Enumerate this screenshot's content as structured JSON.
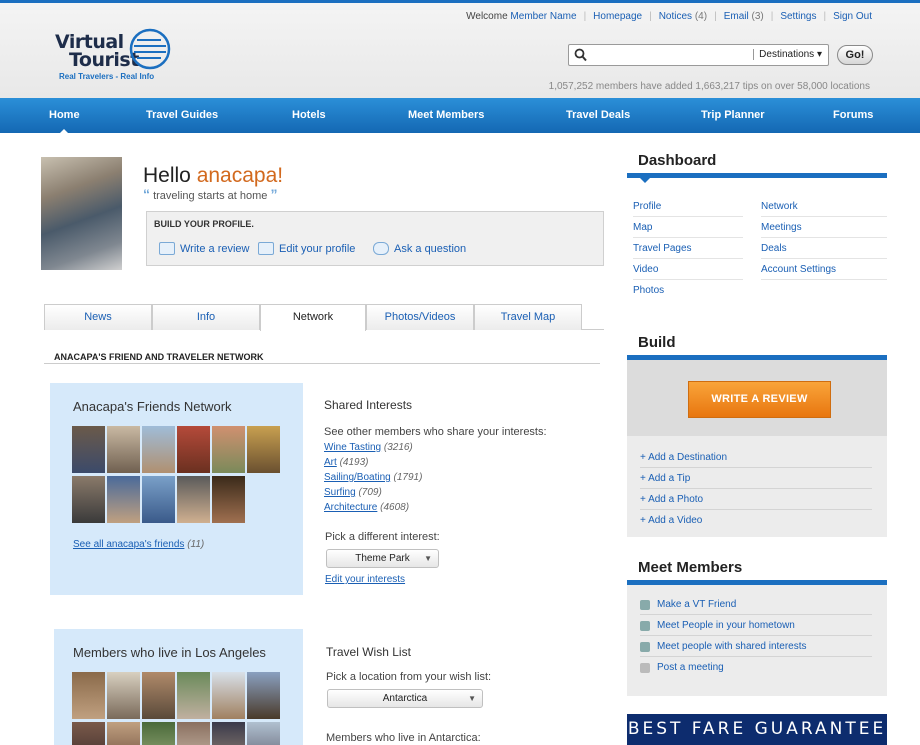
{
  "top_links": {
    "welcome": "Welcome",
    "member_name": "Member Name",
    "homepage": "Homepage",
    "notices": "Notices",
    "notices_count": "(4)",
    "email": "Email",
    "email_count": "(3)",
    "settings": "Settings",
    "sign_out": "Sign Out"
  },
  "logo": {
    "line1": "Virtual",
    "line2": "Tourist",
    "tagline": "Real Travelers - Real Info"
  },
  "search": {
    "placeholder": "",
    "destinations": "Destinations",
    "go": "Go!"
  },
  "stats": "1,057,252 members have added 1,663,217 tips on over 58,000 locations",
  "nav": [
    "Home",
    "Travel Guides",
    "Hotels",
    "Meet Members",
    "Travel Deals",
    "Trip Planner",
    "Forums"
  ],
  "profile": {
    "hello": "Hello",
    "name": "anacapa!",
    "quote": "traveling starts at home",
    "build_title": "BUILD YOUR PROFILE.",
    "write_review": "Write a review",
    "edit_profile": "Edit your profile",
    "ask_question": "Ask a question"
  },
  "tabs": [
    "News",
    "Info",
    "Network",
    "Photos/Videos",
    "Travel Map"
  ],
  "active_tab": "Network",
  "network_title": "ANACAPA'S FRIEND AND TRAVELER NETWORK",
  "friends": {
    "title": "Anacapa's Friends Network",
    "see_all": "See all anacapa's friends",
    "see_all_count": "(11)"
  },
  "shared": {
    "title": "Shared Interests",
    "subtitle": "See other members who share your interests:",
    "items": [
      {
        "label": "Wine Tasting",
        "count": "(3216)"
      },
      {
        "label": "Art",
        "count": "(4193)"
      },
      {
        "label": "Sailing/Boating",
        "count": "(1791)"
      },
      {
        "label": "Surfing",
        "count": "(709)"
      },
      {
        "label": "Architecture",
        "count": "(4608)"
      }
    ],
    "pick": "Pick a different interest:",
    "select_value": "Theme Park",
    "edit": "Edit your interests"
  },
  "la": {
    "title": "Members who live in Los Angeles"
  },
  "wish": {
    "title": "Travel Wish List",
    "pick": "Pick a location from your wish list:",
    "select_value": "Antarctica",
    "members_in": "Members who live in Antarctica:"
  },
  "dashboard": {
    "title": "Dashboard",
    "left": [
      "Profile",
      "Map",
      "Travel Pages",
      "Video",
      "Photos"
    ],
    "right": [
      "Network",
      "Meetings",
      "Deals",
      "Account Settings"
    ]
  },
  "build": {
    "title": "Build",
    "write_review": "WRITE A REVIEW",
    "links": [
      "+ Add a Destination",
      "+ Add a Tip",
      "+ Add a Photo",
      "+ Add a Video"
    ]
  },
  "meet": {
    "title": "Meet Members",
    "links": [
      "Make a VT Friend",
      "Meet People in your hometown",
      "Meet people with shared interests",
      "Post a meeting"
    ]
  },
  "banner": "BEST FARE GUARANTEE"
}
